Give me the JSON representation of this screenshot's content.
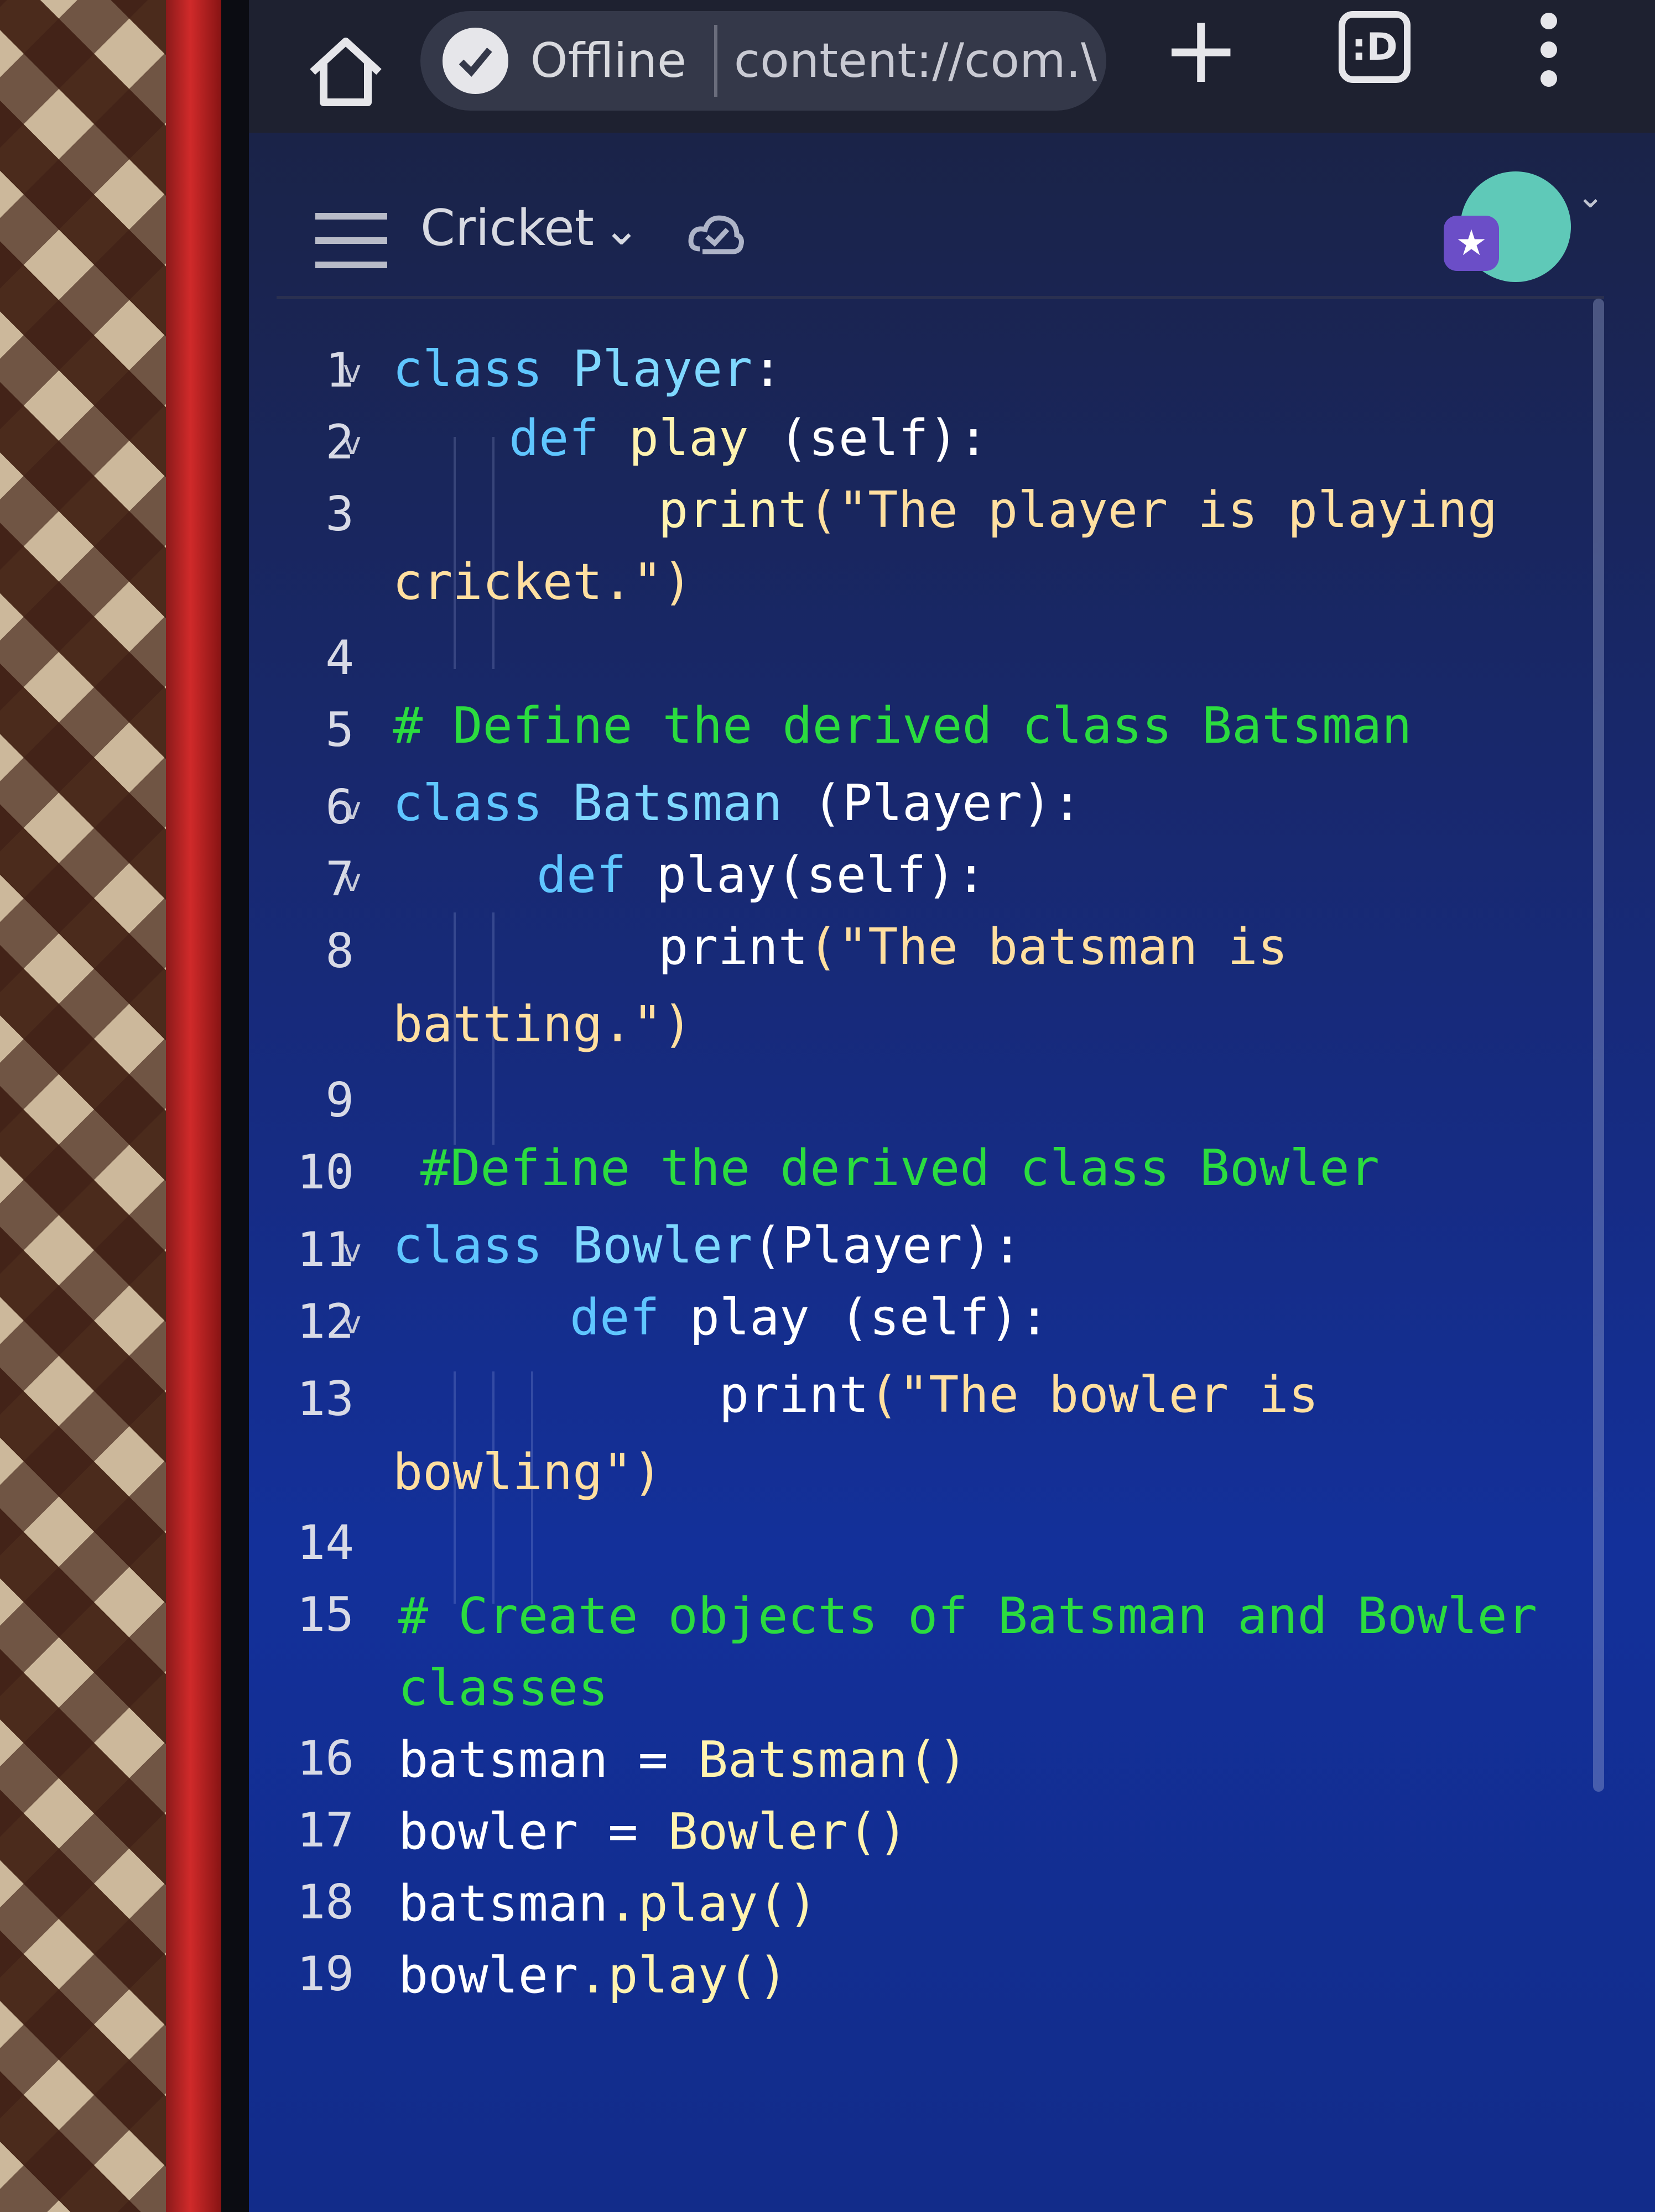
{
  "browser": {
    "status_label": "Offline",
    "url_text": "content://com.\\",
    "tab_count_label": ":D"
  },
  "header": {
    "project_name": "Cricket"
  },
  "editor": {
    "lines": [
      {
        "num": "1",
        "fold": true
      },
      {
        "num": "2",
        "fold": true
      },
      {
        "num": "3",
        "fold": false
      },
      {
        "num": "4",
        "fold": false
      },
      {
        "num": "5",
        "fold": false
      },
      {
        "num": "6",
        "fold": true
      },
      {
        "num": "7",
        "fold": true
      },
      {
        "num": "8",
        "fold": false
      },
      {
        "num": "9",
        "fold": false
      },
      {
        "num": "10",
        "fold": false
      },
      {
        "num": "11",
        "fold": true
      },
      {
        "num": "12",
        "fold": true
      },
      {
        "num": "13",
        "fold": false
      },
      {
        "num": "14",
        "fold": false
      },
      {
        "num": "15",
        "fold": false
      },
      {
        "num": "16",
        "fold": false
      },
      {
        "num": "17",
        "fold": false
      },
      {
        "num": "18",
        "fold": false
      },
      {
        "num": "19",
        "fold": false
      }
    ],
    "code": {
      "l1_kw": "class",
      "l1_name": "Player",
      "l1_end": ":",
      "l2_kw": "def",
      "l2_fn": "play",
      "l2_rest": " (self):",
      "l3_fn": "print",
      "l3_str": "(\"The player is playing",
      "l3_wrap": "cricket.\")",
      "l5_comment": "# Define the derived class Batsman",
      "l6_kw": "class",
      "l6_name": "Batsman",
      "l6_rest": " (Player):",
      "l7_kw": "def",
      "l7_fn": "play",
      "l7_rest": "(self):",
      "l8_fn": "print",
      "l8_str": "(\"The batsman is",
      "l8_wrap": "batting.\")",
      "l10_comment": "#Define the derived class Bowler",
      "l11_kw": "class",
      "l11_name": "Bowler",
      "l11_rest": "(Player):",
      "l12_kw": "def",
      "l12_fn": "play",
      "l12_rest": " (self):",
      "l13_fn": "print",
      "l13_str": "(\"The bowler is",
      "l13_wrap": "bowling\")",
      "l15_comment": "# Create objects of Batsman and Bowler",
      "l15_wrap": "classes",
      "l16_var": "batsman",
      "l16_op": " = ",
      "l16_call": "Batsman()",
      "l17_var": "bowler",
      "l17_op": " = ",
      "l17_call": "Bowler()",
      "l18_var": "batsman",
      "l18_call": ".play()",
      "l19_var": "bowler",
      "l19_call": ".play()"
    }
  }
}
